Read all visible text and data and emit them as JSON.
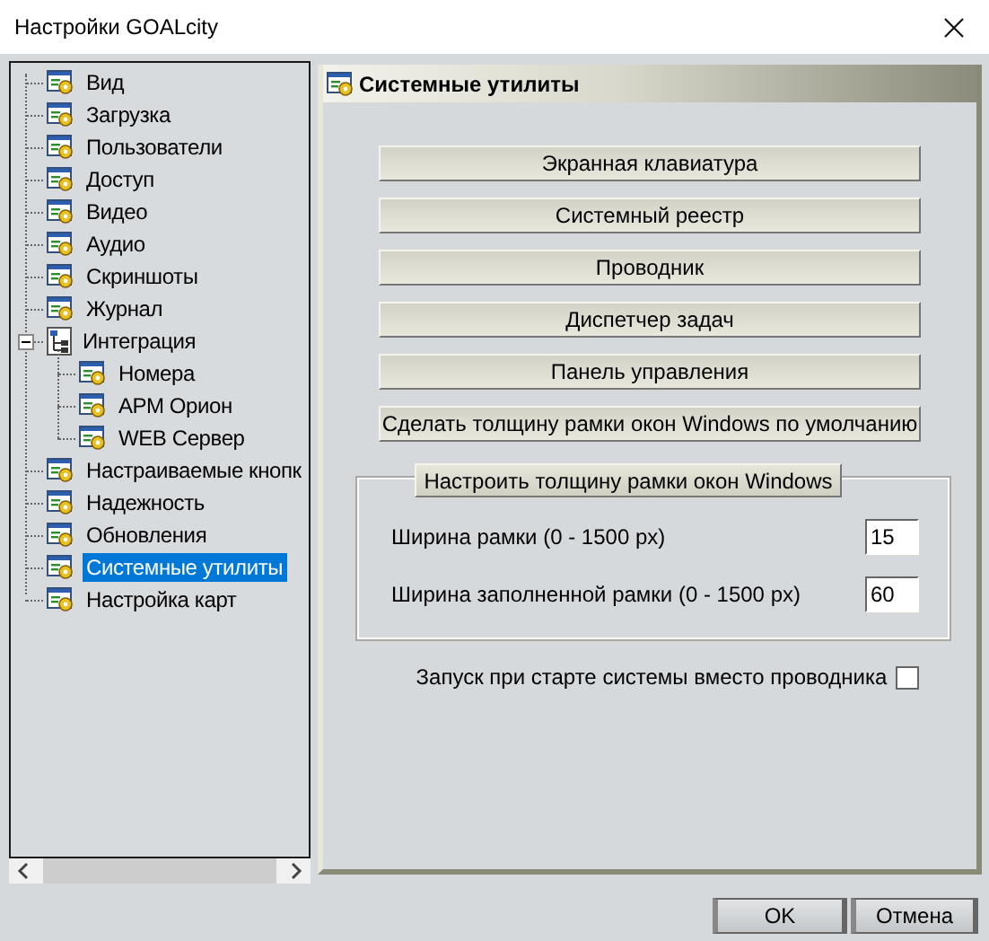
{
  "window": {
    "title": "Настройки GOALcity"
  },
  "tree": [
    {
      "label": "Вид",
      "kind": "page",
      "selected": false
    },
    {
      "label": "Загрузка",
      "kind": "page",
      "selected": false
    },
    {
      "label": "Пользователи",
      "kind": "page",
      "selected": false
    },
    {
      "label": "Доступ",
      "kind": "page",
      "selected": false
    },
    {
      "label": "Видео",
      "kind": "page",
      "selected": false
    },
    {
      "label": "Аудио",
      "kind": "page",
      "selected": false
    },
    {
      "label": "Скриншоты",
      "kind": "page",
      "selected": false
    },
    {
      "label": "Журнал",
      "kind": "page",
      "selected": false
    },
    {
      "label": "Интеграция",
      "kind": "group",
      "selected": false,
      "expanded": true,
      "children": [
        {
          "label": "Номера",
          "kind": "page",
          "selected": false
        },
        {
          "label": "АРМ Орион",
          "kind": "page",
          "selected": false
        },
        {
          "label": "WEB Сервер",
          "kind": "page",
          "selected": false
        }
      ]
    },
    {
      "label": "Настраиваемые кнопк",
      "kind": "page",
      "selected": false
    },
    {
      "label": "Надежность",
      "kind": "page",
      "selected": false
    },
    {
      "label": "Обновления",
      "kind": "page",
      "selected": false
    },
    {
      "label": "Системные утилиты",
      "kind": "page",
      "selected": true
    },
    {
      "label": "Настройка карт",
      "kind": "page",
      "selected": false
    }
  ],
  "panel": {
    "title": "Системные утилиты",
    "buttons": [
      "Экранная клавиатура",
      "Системный реестр",
      "Проводник",
      "Диспетчер задач",
      "Панель управления",
      "Сделать толщину рамки окон Windows по умолчанию"
    ],
    "group": {
      "title": "Настроить толщину рамки окон Windows",
      "fields": [
        {
          "label": "Ширина рамки (0 - 1500 px)",
          "value": "15"
        },
        {
          "label": "Ширина заполненной рамки (0 - 1500 px)",
          "value": "60"
        }
      ]
    },
    "checkbox": {
      "label": "Запуск при старте системы вместо проводника",
      "checked": false
    }
  },
  "dialog_buttons": [
    "OK",
    "Отмена"
  ]
}
